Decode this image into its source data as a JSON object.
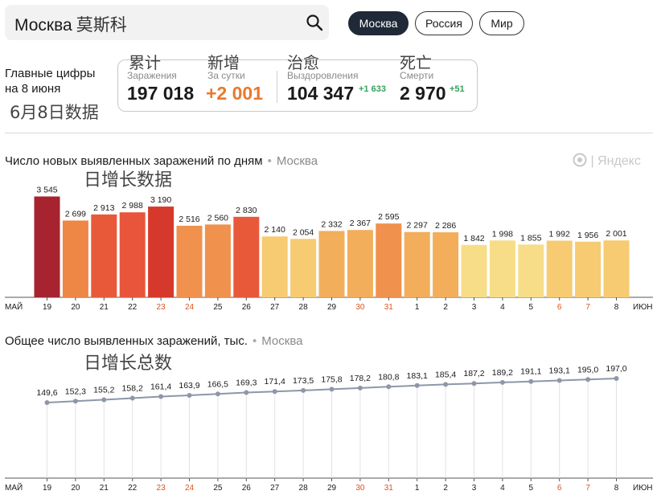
{
  "search": {
    "value": "Москва",
    "annotation": "莫斯科"
  },
  "region_tabs": [
    {
      "label": "Москва",
      "active": true
    },
    {
      "label": "Россия",
      "active": false
    },
    {
      "label": "Мир",
      "active": false
    }
  ],
  "summary": {
    "title_line1": "Главные цифры",
    "title_line2": "на 8 июня",
    "annotation": "6月8日数据",
    "stats": [
      {
        "note": "累计",
        "label": "Заражения",
        "value": "197 018",
        "delta": ""
      },
      {
        "note": "新增",
        "label": "За сутки",
        "value": "+2 001",
        "delta": ""
      },
      {
        "note": "治愈",
        "label": "Выздоровления",
        "value": "104 347",
        "delta": "+1 633"
      },
      {
        "note": "死亡",
        "label": "Смерти",
        "value": "2 970",
        "delta": "+51"
      }
    ]
  },
  "daily_section": {
    "title": "Число новых выявленных заражений по дням",
    "region": "Москва",
    "annotation": "日增长数据",
    "watermark": "| Яндекс"
  },
  "total_section": {
    "title": "Общее число выявленных заражений, тыс.",
    "region": "Москва",
    "annotation": "日增长总数"
  },
  "colors": {
    "accent_orange": "#e9782e",
    "green": "#35a15d",
    "weekend": "#d9541e",
    "line": "#8e97a8"
  },
  "chart_data": [
    {
      "type": "bar",
      "title": "Число новых выявленных заражений по дням",
      "month_start": "МАЙ",
      "month_end": "ИЮН",
      "categories": [
        "19",
        "20",
        "21",
        "22",
        "23",
        "24",
        "25",
        "26",
        "27",
        "28",
        "29",
        "30",
        "31",
        "1",
        "2",
        "3",
        "4",
        "5",
        "6",
        "7",
        "8"
      ],
      "weekend": [
        "23",
        "24",
        "30",
        "31",
        "6",
        "7"
      ],
      "values": [
        3545,
        2699,
        2913,
        2988,
        3190,
        2516,
        2560,
        2830,
        2140,
        2054,
        2332,
        2367,
        2595,
        2297,
        2286,
        1842,
        1998,
        1855,
        1992,
        1956,
        2001
      ],
      "value_labels": [
        "3 545",
        "2 699",
        "2 913",
        "2 988",
        "3 190",
        "2 516",
        "2 560",
        "2 830",
        "2 140",
        "2 054",
        "2 332",
        "2 367",
        "2 595",
        "2 297",
        "2 286",
        "1 842",
        "1 998",
        "1 855",
        "1 992",
        "1 956",
        "2 001"
      ],
      "bar_colors": [
        "#a6232f",
        "#ee8646",
        "#e8593a",
        "#e8553a",
        "#d6382c",
        "#f0914d",
        "#f0914d",
        "#e8593a",
        "#f6cb72",
        "#f6cb72",
        "#f2ae5a",
        "#f2ae5a",
        "#f0914d",
        "#f2ae5a",
        "#f2ae5a",
        "#f8dd88",
        "#f8dd88",
        "#f8dd88",
        "#f6cb72",
        "#f6cb72",
        "#f6cb72"
      ],
      "ylim": [
        0,
        4000
      ]
    },
    {
      "type": "line",
      "title": "Общее число выявленных заражений, тыс.",
      "month_start": "МАЙ",
      "month_end": "ИЮН",
      "categories": [
        "19",
        "20",
        "21",
        "22",
        "23",
        "24",
        "25",
        "26",
        "27",
        "28",
        "29",
        "30",
        "31",
        "1",
        "2",
        "3",
        "4",
        "5",
        "6",
        "7",
        "8"
      ],
      "weekend": [
        "23",
        "24",
        "30",
        "31",
        "6",
        "7"
      ],
      "values": [
        149.6,
        152.3,
        155.2,
        158.2,
        161.4,
        163.9,
        166.5,
        169.3,
        171.4,
        173.5,
        175.8,
        178.2,
        180.8,
        183.1,
        185.4,
        187.2,
        189.2,
        191.1,
        193.1,
        195.0,
        197.0
      ],
      "value_labels": [
        "149,6",
        "152,3",
        "155,2",
        "158,2",
        "161,4",
        "163,9",
        "166,5",
        "169,3",
        "171,4",
        "173,5",
        "175,8",
        "178,2",
        "180,8",
        "183,1",
        "185,4",
        "187,2",
        "189,2",
        "191,1",
        "193,1",
        "195,0",
        "197,0"
      ],
      "ylim": [
        0,
        200
      ]
    }
  ]
}
